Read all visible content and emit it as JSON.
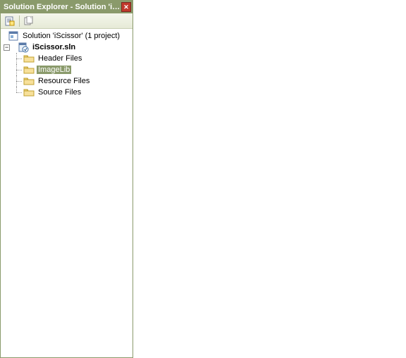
{
  "title": "Solution Explorer - Solution 'iSci...",
  "tree": {
    "root": "Solution 'iScissor' (1 project)",
    "project": "iScissor.sln",
    "folders": {
      "header": "Header Files",
      "imagelib": "ImageLib",
      "resource": "Resource Files",
      "source": "Source Files"
    }
  }
}
